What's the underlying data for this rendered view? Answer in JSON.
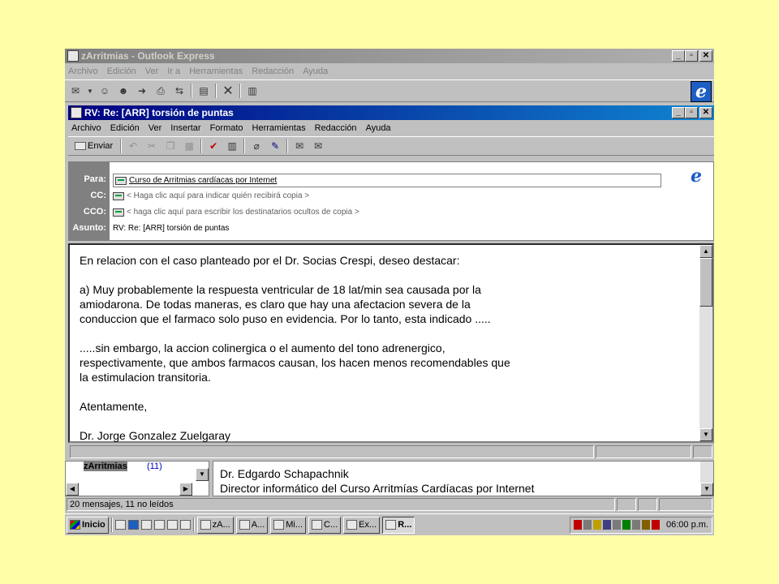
{
  "main_window": {
    "title": "zArritmias - Outlook Express",
    "menu": [
      "Archivo",
      "Edición",
      "Ver",
      "Ir a",
      "Herramientas",
      "Redacción",
      "Ayuda"
    ]
  },
  "message_window": {
    "title": "RV: Re: [ARR]  torsión de puntas",
    "menu": [
      "Archivo",
      "Edición",
      "Ver",
      "Insertar",
      "Formato",
      "Herramientas",
      "Redacción",
      "Ayuda"
    ],
    "toolbar": {
      "send_label": "Enviar"
    },
    "headers": {
      "to_label": "Para:",
      "to_value": "Curso de Arritmias cardíacas por Internet",
      "cc_label": "CC:",
      "cc_value": "< Haga clic aquí para indicar quién recibirá copia >",
      "bcc_label": "CCO:",
      "bcc_value": "< haga clic aquí para escribir los destinatarios ocultos de copia >",
      "subject_label": "Asunto:",
      "subject_value": "RV: Re: [ARR]  torsión de puntas"
    },
    "body": "En relacion con el caso planteado por el Dr. Socias Crespi, deseo destacar:\n\na) Muy probablemente la respuesta ventricular de 18 lat/min sea causada por la\namiodarona. De todas maneras, es claro que hay una afectacion severa de la\nconduccion que el farmaco solo puso en evidencia. Por lo tanto, esta indicado .....\n\n.....sin embargo, la accion colinergica o el aumento del tono adrenergico,\nrespectivamente, que ambos farmacos causan, los hacen menos recomendables que\nla estimulacion transitoria.\n\nAtentamente,\n\nDr. Jorge Gonzalez Zuelgaray"
  },
  "background_panes": {
    "folder_label": "zArritmias",
    "folder_count": "(11)",
    "preview_line1": "Dr. Edgardo Schapachnik",
    "preview_line2": "Director informático del Curso Arritmías Cardíacas por Internet"
  },
  "main_status": {
    "text": "20 mensajes, 11 no leídos"
  },
  "taskbar": {
    "start_label": "Inicio",
    "tasks": [
      "zA...",
      "A...",
      "Mi...",
      "C...",
      "Ex...",
      "R..."
    ],
    "clock": "06:00 p.m."
  }
}
